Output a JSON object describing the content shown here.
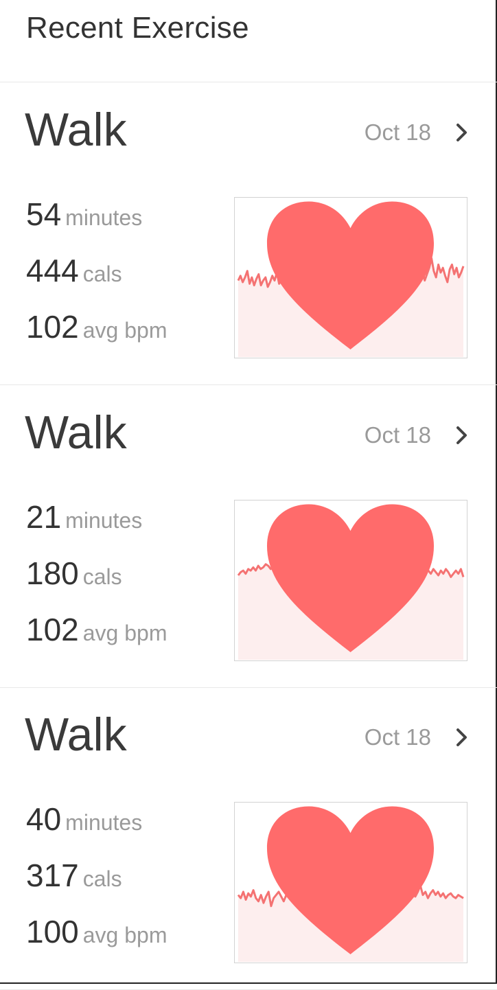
{
  "header": {
    "title": "Recent Exercise"
  },
  "colors": {
    "heart": "#ff6b6b",
    "line": "#f47272",
    "fill": "#fdeeee"
  },
  "icons": {
    "heart": "heart-icon",
    "chevron": "chevron-right-icon"
  },
  "exercises": [
    {
      "activity": "Walk",
      "date": "Oct 18",
      "minutes": "54",
      "minutes_unit": "minutes",
      "cals": "444",
      "cals_unit": "cals",
      "bpm": "102",
      "bpm_unit": "avg bpm",
      "heart_rate_trace": [
        0.52,
        0.49,
        0.53,
        0.5,
        0.46,
        0.54,
        0.5,
        0.55,
        0.51,
        0.48,
        0.55,
        0.52,
        0.5,
        0.56,
        0.53,
        0.49,
        0.52,
        0.47,
        0.54,
        0.51,
        0.5,
        0.55,
        0.49,
        0.46,
        0.54,
        0.52,
        0.57,
        0.5,
        0.51,
        0.53,
        0.46,
        0.43,
        0.53,
        0.5,
        0.55,
        0.48,
        0.52,
        0.5,
        0.49,
        0.46,
        0.51,
        0.54,
        0.44,
        0.5,
        0.52,
        0.47,
        0.49,
        0.53,
        0.5,
        0.45,
        0.52,
        0.49,
        0.44,
        0.53,
        0.51,
        0.5,
        0.48,
        0.54,
        0.51,
        0.47,
        0.52,
        0.49,
        0.55,
        0.52,
        0.48,
        0.5,
        0.46,
        0.51,
        0.53,
        0.49,
        0.47,
        0.5,
        0.42,
        0.48,
        0.52,
        0.46,
        0.49,
        0.54,
        0.44,
        0.5,
        0.39,
        0.45,
        0.52,
        0.48,
        0.44,
        0.38,
        0.46,
        0.5,
        0.42,
        0.47,
        0.44,
        0.49,
        0.53,
        0.45,
        0.42,
        0.48,
        0.44,
        0.5,
        0.47,
        0.43
      ]
    },
    {
      "activity": "Walk",
      "date": "Oct 18",
      "minutes": "21",
      "minutes_unit": "minutes",
      "cals": "180",
      "cals_unit": "cals",
      "bpm": "102",
      "bpm_unit": "avg bpm",
      "heart_rate_trace": [
        0.47,
        0.45,
        0.44,
        0.46,
        0.43,
        0.44,
        0.42,
        0.44,
        0.41,
        0.43,
        0.42,
        0.4,
        0.41,
        0.43,
        0.41,
        0.44,
        0.42,
        0.4,
        0.45,
        0.42,
        0.39,
        0.41,
        0.43,
        0.46,
        0.44,
        0.48,
        0.45,
        0.5,
        0.46,
        0.47,
        0.44,
        0.46,
        0.45,
        0.48,
        0.46,
        0.44,
        0.47,
        0.45,
        0.43,
        0.46,
        0.44,
        0.42,
        0.44,
        0.41,
        0.43,
        0.46,
        0.44,
        0.48,
        0.52,
        0.5,
        0.47,
        0.44,
        0.46,
        0.49,
        0.46,
        0.43,
        0.46,
        0.48,
        0.45,
        0.47,
        0.44,
        0.46,
        0.48,
        0.45,
        0.43,
        0.46,
        0.42,
        0.44,
        0.46,
        0.43,
        0.45,
        0.42,
        0.44,
        0.47,
        0.44,
        0.42,
        0.44,
        0.46,
        0.43,
        0.45,
        0.47,
        0.44,
        0.46,
        0.43,
        0.45,
        0.48,
        0.46,
        0.44,
        0.46,
        0.43,
        0.48
      ]
    },
    {
      "activity": "Walk",
      "date": "Oct 18",
      "minutes": "40",
      "minutes_unit": "minutes",
      "cals": "317",
      "cals_unit": "cals",
      "bpm": "100",
      "bpm_unit": "avg bpm",
      "heart_rate_trace": [
        0.58,
        0.6,
        0.56,
        0.61,
        0.57,
        0.59,
        0.55,
        0.6,
        0.62,
        0.58,
        0.63,
        0.59,
        0.56,
        0.65,
        0.6,
        0.58,
        0.56,
        0.59,
        0.62,
        0.58,
        0.56,
        0.6,
        0.57,
        0.61,
        0.58,
        0.56,
        0.59,
        0.55,
        0.58,
        0.61,
        0.57,
        0.55,
        0.58,
        0.6,
        0.56,
        0.54,
        0.59,
        0.57,
        0.61,
        0.58,
        0.55,
        0.58,
        0.61,
        0.57,
        0.6,
        0.58,
        0.56,
        0.59,
        0.57,
        0.6,
        0.62,
        0.58,
        0.61,
        0.57,
        0.59,
        0.56,
        0.6,
        0.58,
        0.55,
        0.58,
        0.61,
        0.56,
        0.59,
        0.57,
        0.6,
        0.58,
        0.54,
        0.58,
        0.61,
        0.57,
        0.59,
        0.56,
        0.52,
        0.58,
        0.56,
        0.6,
        0.57,
        0.55,
        0.58,
        0.56,
        0.59,
        0.57,
        0.6,
        0.58,
        0.57,
        0.59,
        0.6,
        0.58,
        0.59,
        0.6
      ]
    }
  ]
}
